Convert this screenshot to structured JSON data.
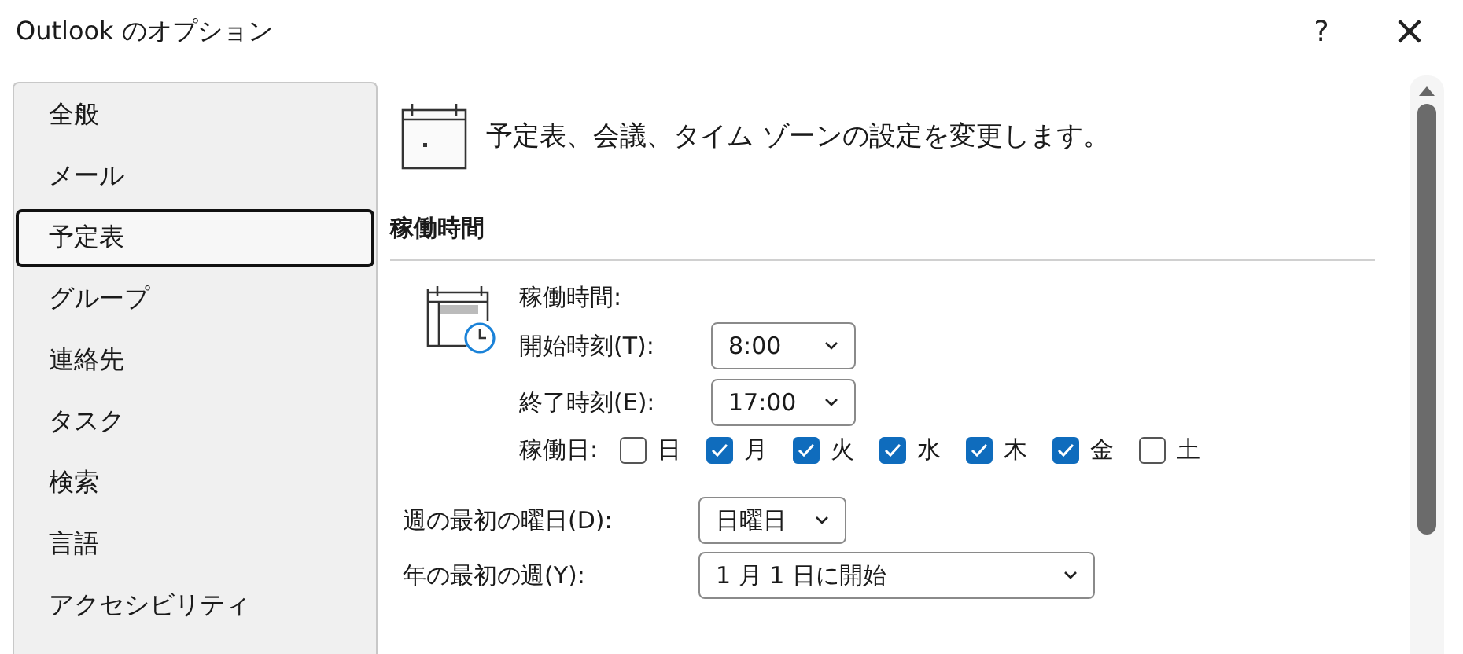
{
  "window": {
    "title": "Outlook のオプション",
    "help": "?",
    "close": "×"
  },
  "sidebar": {
    "items": [
      {
        "label": "全般",
        "selected": false
      },
      {
        "label": "メール",
        "selected": false
      },
      {
        "label": "予定表",
        "selected": true
      },
      {
        "label": "グループ",
        "selected": false
      },
      {
        "label": "連絡先",
        "selected": false
      },
      {
        "label": "タスク",
        "selected": false
      },
      {
        "label": "検索",
        "selected": false
      },
      {
        "label": "言語",
        "selected": false
      },
      {
        "label": "アクセシビリティ",
        "selected": false
      }
    ]
  },
  "header": {
    "text": "予定表、会議、タイム ゾーンの設定を変更します。"
  },
  "section": {
    "title": "稼働時間",
    "work_hours_label": "稼働時間:",
    "start": {
      "label": "開始時刻(T):",
      "value": "8:00"
    },
    "end": {
      "label": "終了時刻(E):",
      "value": "17:00"
    },
    "days_label": "稼働日:",
    "days": [
      {
        "label": "日",
        "checked": false
      },
      {
        "label": "月",
        "checked": true
      },
      {
        "label": "火",
        "checked": true
      },
      {
        "label": "水",
        "checked": true
      },
      {
        "label": "木",
        "checked": true
      },
      {
        "label": "金",
        "checked": true
      },
      {
        "label": "土",
        "checked": false
      }
    ],
    "first_day": {
      "label": "週の最初の曜日(D):",
      "value": "日曜日"
    },
    "first_week": {
      "label": "年の最初の週(Y):",
      "value": "1 月 1 日に開始"
    }
  }
}
